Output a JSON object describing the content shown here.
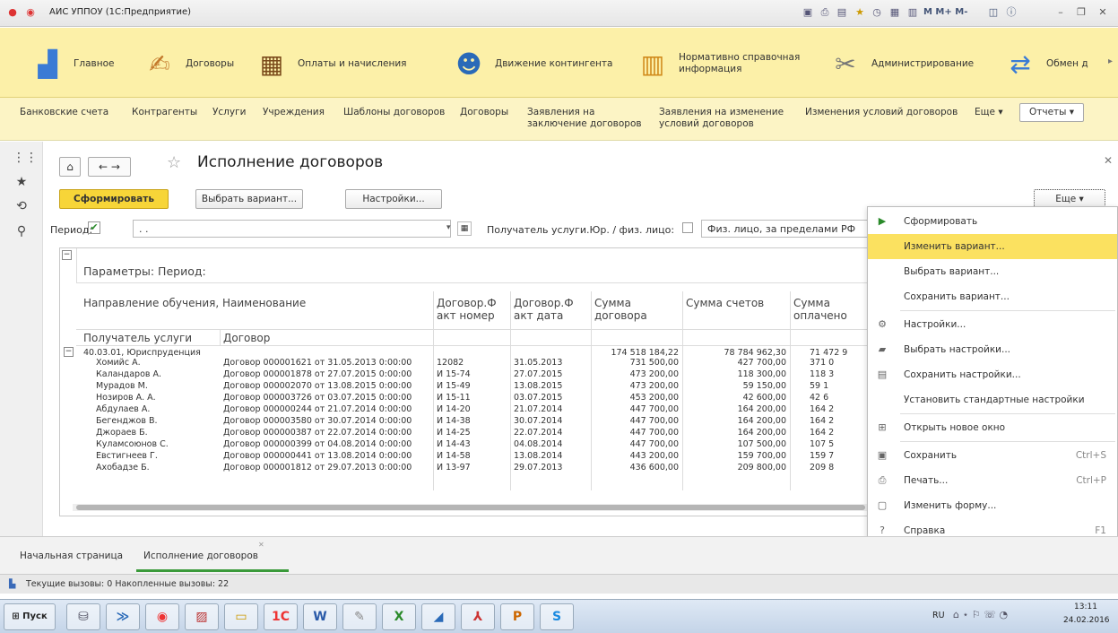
{
  "window": {
    "title": "АИС УППОУ (1С:Предприятие)",
    "tb_right": "М  М+  М-"
  },
  "sections": [
    {
      "label": "Главное",
      "icon": "desk-icon"
    },
    {
      "label": "Договоры",
      "icon": "handshake-icon"
    },
    {
      "label": "Оплаты и начисления",
      "icon": "abacus-icon"
    },
    {
      "label": "Движение контингента",
      "icon": "person-icon"
    },
    {
      "label": "Нормативно справочная\nинформация",
      "icon": "books-icon"
    },
    {
      "label": "Администрирование",
      "icon": "tools-icon"
    },
    {
      "label": "Обмен д",
      "icon": "exchange-icon"
    }
  ],
  "subnav": [
    "Банковские счета",
    "Контрагенты",
    "Услуги",
    "Учреждения",
    "Шаблоны договоров",
    "Договоры",
    "Заявления на\nзаключение договоров",
    "Заявления на изменение\nусловий договоров",
    "Изменения условий договоров",
    "Еще ▾",
    "Отчеты ▾"
  ],
  "form": {
    "title": "Исполнение договоров",
    "btn_generate": "Сформировать",
    "btn_choose_variant": "Выбрать вариант...",
    "btn_settings": "Настройки...",
    "btn_more": "Еще",
    "period_label": "Период:",
    "period_value": ". .",
    "recipient_label": "Получатель услуги.Юр. / физ. лицо:",
    "recipient_value": "Физ. лицо, за пределами РФ"
  },
  "report": {
    "params": "Параметры:   Период:",
    "h_direction": "Направление обучения, Наименование",
    "h_num": "Договор.Ф\nакт номер",
    "h_date": "Договор.Ф\nакт дата",
    "h_sum": "Сумма\nдоговора",
    "h_bills": "Сумма счетов",
    "h_paid": "Сумма\nоплачено",
    "h_recipient": "Получатель услуги",
    "h_contract": "Договор",
    "group": {
      "name": "40.03.01, Юриспруденция",
      "sum": "174 518 184,22",
      "bills": "78 784 962,30",
      "paid": "71 472 9"
    },
    "rows": [
      {
        "name": "Хомийс А.",
        "contract": "Договор 000001621 от 31.05.2013 0:00:00",
        "num": "12082",
        "date": "31.05.2013",
        "sum": "731 500,00",
        "bills": "427 700,00",
        "paid": "371 0"
      },
      {
        "name": "Каландаров А.",
        "contract": "Договор 000001878 от 27.07.2015 0:00:00",
        "num": "И 15-74",
        "date": "27.07.2015",
        "sum": "473 200,00",
        "bills": "118 300,00",
        "paid": "118 3"
      },
      {
        "name": "Мурадов М.",
        "contract": "Договор 000002070 от 13.08.2015 0:00:00",
        "num": "И 15-49",
        "date": "13.08.2015",
        "sum": "473 200,00",
        "bills": "59 150,00",
        "paid": "59 1"
      },
      {
        "name": "Нозиров А. А.",
        "contract": "Договор 000003726 от 03.07.2015 0:00:00",
        "num": "И 15-11",
        "date": "03.07.2015",
        "sum": "453 200,00",
        "bills": "42 600,00",
        "paid": "42 6"
      },
      {
        "name": "Абдулаев А.",
        "contract": "Договор 000000244 от 21.07.2014 0:00:00",
        "num": "И 14-20",
        "date": "21.07.2014",
        "sum": "447 700,00",
        "bills": "164 200,00",
        "paid": "164 2"
      },
      {
        "name": "Бегенджов В.",
        "contract": "Договор 000003580 от 30.07.2014 0:00:00",
        "num": "И 14-38",
        "date": "30.07.2014",
        "sum": "447 700,00",
        "bills": "164 200,00",
        "paid": "164 2"
      },
      {
        "name": "Джораев Б.",
        "contract": "Договор 000000387 от 22.07.2014 0:00:00",
        "num": "И 14-25",
        "date": "22.07.2014",
        "sum": "447 700,00",
        "bills": "164 200,00",
        "paid": "164 2"
      },
      {
        "name": "Куламсоюнов С.",
        "contract": "Договор 000000399 от 04.08.2014 0:00:00",
        "num": "И 14-43",
        "date": "04.08.2014",
        "sum": "447 700,00",
        "bills": "107 500,00",
        "paid": "107 5"
      },
      {
        "name": "Евстигнеев Г.",
        "contract": "Договор 000000441 от 13.08.2014 0:00:00",
        "num": "И 14-58",
        "date": "13.08.2014",
        "sum": "443 200,00",
        "bills": "159 700,00",
        "paid": "159 7"
      },
      {
        "name": "Ахобадзе Б.",
        "contract": "Договор 000001812 от 29.07.2013 0:00:00",
        "num": "И 13-97",
        "date": "29.07.2013",
        "sum": "436 600,00",
        "bills": "209 800,00",
        "paid": "209 8"
      }
    ]
  },
  "menu": [
    {
      "label": "Сформировать",
      "icon": "play-icon",
      "shortcut": ""
    },
    {
      "label": "Изменить вариант...",
      "icon": "",
      "shortcut": "",
      "highlight": true
    },
    {
      "label": "Выбрать вариант...",
      "icon": "",
      "shortcut": ""
    },
    {
      "label": "Сохранить вариант...",
      "icon": "",
      "shortcut": ""
    },
    {
      "label": "Настройки...",
      "icon": "settings-icon",
      "shortcut": ""
    },
    {
      "label": "Выбрать настройки...",
      "icon": "folder-icon",
      "shortcut": ""
    },
    {
      "label": "Сохранить настройки...",
      "icon": "save-settings-icon",
      "shortcut": ""
    },
    {
      "label": "Установить стандартные настройки",
      "icon": "",
      "shortcut": ""
    },
    {
      "label": "Открыть новое окно",
      "icon": "plus-icon",
      "shortcut": ""
    },
    {
      "label": "Сохранить",
      "icon": "floppy-icon",
      "shortcut": "Ctrl+S"
    },
    {
      "label": "Печать...",
      "icon": "printer-icon",
      "shortcut": "Ctrl+P"
    },
    {
      "label": "Изменить форму...",
      "icon": "form-icon",
      "shortcut": ""
    },
    {
      "label": "Справка",
      "icon": "help-icon",
      "shortcut": "F1"
    }
  ],
  "tabs": [
    "Начальная страница",
    "Исполнение договоров"
  ],
  "status": "Текущие вызовы: 0   Накопленные вызовы: 22",
  "taskbar": {
    "start": "Пуск",
    "lang": "RU",
    "time": "13:11",
    "date": "24.02.2016"
  }
}
